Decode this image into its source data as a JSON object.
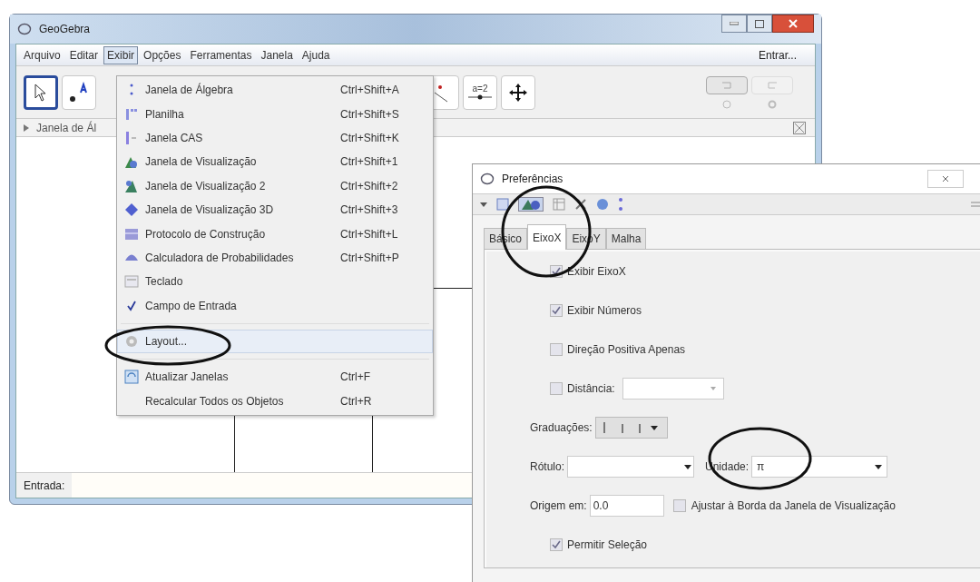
{
  "main_window": {
    "title": "GeoGebra",
    "menu": [
      {
        "label": "Arquivo",
        "selected": false
      },
      {
        "label": "Editar",
        "selected": false
      },
      {
        "label": "Exibir",
        "selected": true
      },
      {
        "label": "Opções",
        "selected": false
      },
      {
        "label": "Ferramentas",
        "selected": false
      },
      {
        "label": "Janela",
        "selected": false
      },
      {
        "label": "Ajuda",
        "selected": false
      }
    ],
    "login": "Entrar...",
    "tools": [
      {
        "selected": true
      },
      {
        "selected": false
      },
      {
        "selected": false
      },
      {
        "selected": false,
        "label": "a=2"
      },
      {
        "selected": false
      }
    ],
    "algebra_header": "Janela de Ál",
    "input_label": "Entrada:"
  },
  "view_menu": {
    "items": [
      {
        "kind": "item",
        "label": "Janela de Álgebra",
        "shortcut": "Ctrl+Shift+A",
        "selected": false
      },
      {
        "kind": "item",
        "label": "Planilha",
        "shortcut": "Ctrl+Shift+S",
        "selected": false
      },
      {
        "kind": "item",
        "label": "Janela CAS",
        "shortcut": "Ctrl+Shift+K",
        "selected": false
      },
      {
        "kind": "item",
        "label": "Janela de Visualização",
        "shortcut": "Ctrl+Shift+1",
        "selected": false
      },
      {
        "kind": "item",
        "label": "Janela de Visualização 2",
        "shortcut": "Ctrl+Shift+2",
        "selected": false
      },
      {
        "kind": "item",
        "label": "Janela de Visualização 3D",
        "shortcut": "Ctrl+Shift+3",
        "selected": false
      },
      {
        "kind": "item",
        "label": "Protocolo de Construção",
        "shortcut": "Ctrl+Shift+L",
        "selected": false
      },
      {
        "kind": "item",
        "label": "Calculadora de Probabilidades",
        "shortcut": "Ctrl+Shift+P",
        "selected": false
      },
      {
        "kind": "item",
        "label": "Teclado",
        "selected": false
      },
      {
        "kind": "check",
        "label": "Campo de Entrada",
        "checked": true,
        "selected": false
      },
      {
        "kind": "separator"
      },
      {
        "kind": "item",
        "label": "Layout...",
        "selected": true
      },
      {
        "kind": "separator"
      },
      {
        "kind": "item",
        "label": "Atualizar Janelas",
        "shortcut": "Ctrl+F",
        "selected": false
      },
      {
        "kind": "item",
        "label": "Recalcular Todos os Objetos",
        "shortcut": "Ctrl+R",
        "selected": false
      }
    ]
  },
  "preferences": {
    "title": "Preferências",
    "tabs": [
      {
        "label": "Básico",
        "selected": false
      },
      {
        "label": "EixoX",
        "selected": true
      },
      {
        "label": "EixoY",
        "selected": false
      },
      {
        "label": "Malha",
        "selected": false
      }
    ],
    "options": [
      {
        "kind": "checkbox",
        "label": "Exibir EixoX",
        "checked": true
      },
      {
        "kind": "checkbox",
        "label": "Exibir Números",
        "checked": true
      },
      {
        "kind": "checkbox",
        "label": "Direção Positiva Apenas",
        "checked": false
      },
      {
        "kind": "checkbox_combo",
        "label": "Distância:",
        "checked": false
      },
      {
        "kind": "ticks",
        "label": "Graduações:"
      },
      {
        "kind": "label_unit",
        "label": "Rótulo:",
        "unit_label": "Unidade:",
        "unit_value": "π"
      },
      {
        "kind": "origin",
        "label": "Origem em:",
        "value": "0.0",
        "check_label": "Ajustar à Borda da Janela de Visualização",
        "checked": false
      },
      {
        "kind": "checkbox",
        "label": "Permitir Seleção",
        "checked": true
      }
    ]
  }
}
